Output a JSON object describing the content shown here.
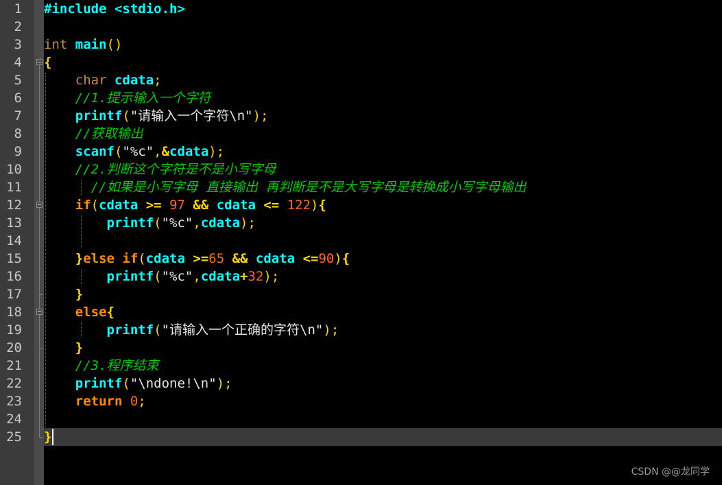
{
  "editor": {
    "lines": [
      {
        "num": "1",
        "tokens": [
          {
            "c": "pre",
            "t": "#include <stdio.h>"
          }
        ]
      },
      {
        "num": "2",
        "tokens": []
      },
      {
        "num": "3",
        "tokens": [
          {
            "c": "type",
            "t": "int "
          },
          {
            "c": "fn",
            "t": "main"
          },
          {
            "c": "punct",
            "t": "()"
          }
        ]
      },
      {
        "num": "4",
        "tokens": [
          {
            "c": "brace",
            "t": "{"
          }
        ]
      },
      {
        "num": "5",
        "tokens": [
          {
            "c": "type",
            "t": "    char "
          },
          {
            "c": "id",
            "t": "cdata"
          },
          {
            "c": "punct",
            "t": ";"
          }
        ]
      },
      {
        "num": "6",
        "tokens": [
          {
            "c": "com",
            "t": "    //1.提示输入一个字符"
          }
        ]
      },
      {
        "num": "7",
        "tokens": [
          {
            "c": "fn",
            "t": "    printf"
          },
          {
            "c": "punct",
            "t": "("
          },
          {
            "c": "str",
            "t": "\"请输入一个字符\\n\""
          },
          {
            "c": "punct",
            "t": ");"
          }
        ]
      },
      {
        "num": "8",
        "tokens": [
          {
            "c": "com",
            "t": "    //获取输出"
          }
        ]
      },
      {
        "num": "9",
        "tokens": [
          {
            "c": "fn",
            "t": "    scanf"
          },
          {
            "c": "punct",
            "t": "("
          },
          {
            "c": "str",
            "t": "\"%c\""
          },
          {
            "c": "punct",
            "t": ","
          },
          {
            "c": "op",
            "t": "&"
          },
          {
            "c": "id",
            "t": "cdata"
          },
          {
            "c": "punct",
            "t": ");"
          }
        ]
      },
      {
        "num": "10",
        "tokens": [
          {
            "c": "com",
            "t": "    //2.判断这个字符是不是小写字母"
          }
        ]
      },
      {
        "num": "11",
        "tokens": [
          {
            "c": "com",
            "t": "      //如果是小写字母 直接输出 再判断是不是大写字母是转换成小写字母输出"
          }
        ]
      },
      {
        "num": "12",
        "tokens": [
          {
            "c": "kw",
            "t": "    if"
          },
          {
            "c": "punct",
            "t": "("
          },
          {
            "c": "id",
            "t": "cdata "
          },
          {
            "c": "op",
            "t": ">= "
          },
          {
            "c": "num",
            "t": "97 "
          },
          {
            "c": "op",
            "t": "&& "
          },
          {
            "c": "id",
            "t": "cdata "
          },
          {
            "c": "op",
            "t": "<= "
          },
          {
            "c": "num",
            "t": "122"
          },
          {
            "c": "punct",
            "t": ")"
          },
          {
            "c": "brace",
            "t": "{"
          }
        ]
      },
      {
        "num": "13",
        "tokens": [
          {
            "c": "fn",
            "t": "        printf"
          },
          {
            "c": "punct",
            "t": "("
          },
          {
            "c": "str",
            "t": "\"%c\""
          },
          {
            "c": "punct",
            "t": ","
          },
          {
            "c": "id",
            "t": "cdata"
          },
          {
            "c": "punct",
            "t": ");"
          }
        ]
      },
      {
        "num": "14",
        "tokens": []
      },
      {
        "num": "15",
        "tokens": [
          {
            "c": "brace",
            "t": "    }"
          },
          {
            "c": "kw",
            "t": "else if"
          },
          {
            "c": "punct",
            "t": "("
          },
          {
            "c": "id",
            "t": "cdata "
          },
          {
            "c": "op",
            "t": ">="
          },
          {
            "c": "num",
            "t": "65 "
          },
          {
            "c": "op",
            "t": "&& "
          },
          {
            "c": "id",
            "t": "cdata "
          },
          {
            "c": "op",
            "t": "<="
          },
          {
            "c": "num",
            "t": "90"
          },
          {
            "c": "punct",
            "t": ")"
          },
          {
            "c": "brace",
            "t": "{"
          }
        ]
      },
      {
        "num": "16",
        "tokens": [
          {
            "c": "fn",
            "t": "        printf"
          },
          {
            "c": "punct",
            "t": "("
          },
          {
            "c": "str",
            "t": "\"%c\""
          },
          {
            "c": "punct",
            "t": ","
          },
          {
            "c": "id",
            "t": "cdata"
          },
          {
            "c": "op",
            "t": "+"
          },
          {
            "c": "num",
            "t": "32"
          },
          {
            "c": "punct",
            "t": ");"
          }
        ]
      },
      {
        "num": "17",
        "tokens": [
          {
            "c": "brace",
            "t": "    }"
          }
        ]
      },
      {
        "num": "18",
        "tokens": [
          {
            "c": "kw",
            "t": "    else"
          },
          {
            "c": "brace",
            "t": "{"
          }
        ]
      },
      {
        "num": "19",
        "tokens": [
          {
            "c": "fn",
            "t": "        printf"
          },
          {
            "c": "punct",
            "t": "("
          },
          {
            "c": "str",
            "t": "\"请输入一个正确的字符\\n\""
          },
          {
            "c": "punct",
            "t": ");"
          }
        ]
      },
      {
        "num": "20",
        "tokens": [
          {
            "c": "brace",
            "t": "    }"
          }
        ]
      },
      {
        "num": "21",
        "tokens": [
          {
            "c": "com",
            "t": "    //3.程序结束"
          }
        ]
      },
      {
        "num": "22",
        "tokens": [
          {
            "c": "fn",
            "t": "    printf"
          },
          {
            "c": "punct",
            "t": "("
          },
          {
            "c": "str",
            "t": "\"\\ndone!\\n\""
          },
          {
            "c": "punct",
            "t": ");"
          }
        ]
      },
      {
        "num": "23",
        "tokens": [
          {
            "c": "kw",
            "t": "    return "
          },
          {
            "c": "num",
            "t": "0"
          },
          {
            "c": "punct",
            "t": ";"
          }
        ]
      },
      {
        "num": "24",
        "tokens": []
      },
      {
        "num": "25",
        "tokens": [
          {
            "c": "brace",
            "t": "}"
          }
        ]
      }
    ],
    "current_line": 25
  },
  "watermark": "CSDN @@龙同学"
}
